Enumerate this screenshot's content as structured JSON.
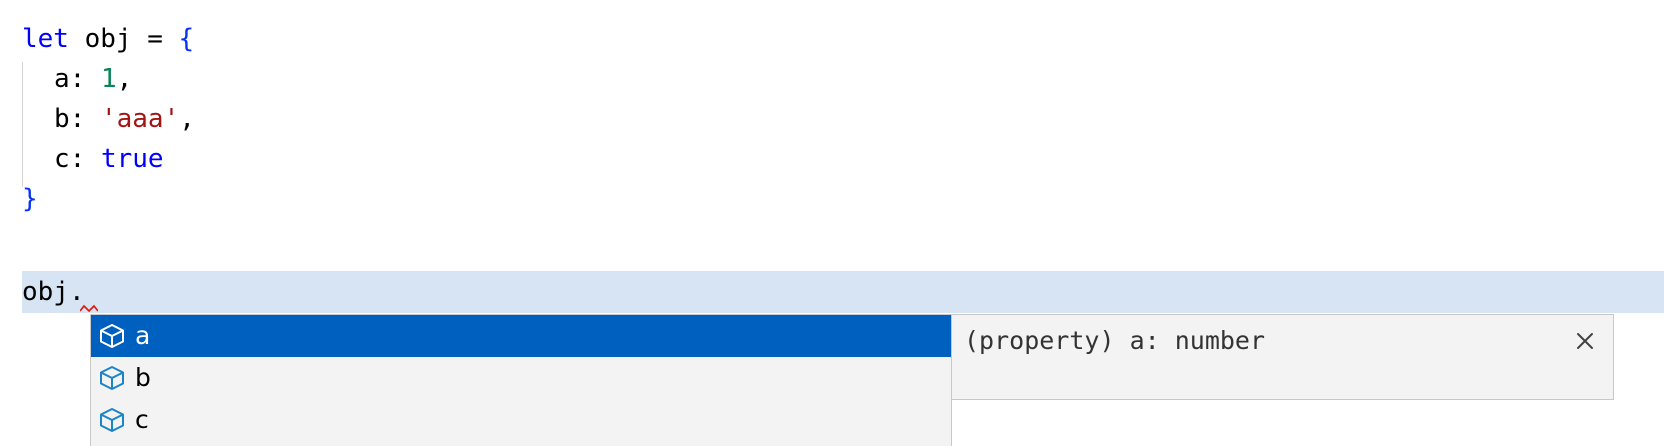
{
  "code": {
    "line1": {
      "kw": "let",
      "name": " obj = ",
      "brace": "{"
    },
    "line2": {
      "key": "a: ",
      "value": "1",
      "punct": ","
    },
    "line3": {
      "key": "b: ",
      "value": "'aaa'",
      "punct": ","
    },
    "line4": {
      "key": "c: ",
      "value": "true"
    },
    "line5": {
      "brace": "}"
    },
    "line6": {
      "text": "obj."
    }
  },
  "suggest": {
    "items": [
      {
        "label": "a",
        "icon": "property-icon",
        "selected": true
      },
      {
        "label": "b",
        "icon": "property-icon",
        "selected": false
      },
      {
        "label": "c",
        "icon": "property-icon",
        "selected": false
      }
    ]
  },
  "details": {
    "signature": "(property) a: number",
    "close_icon": "close-icon"
  },
  "colors": {
    "keyword": "#0000ff",
    "number": "#098658",
    "string": "#a31515",
    "selection": "#0060c0",
    "current_line": "#d6e4f4",
    "icon": "#1a85c8"
  }
}
